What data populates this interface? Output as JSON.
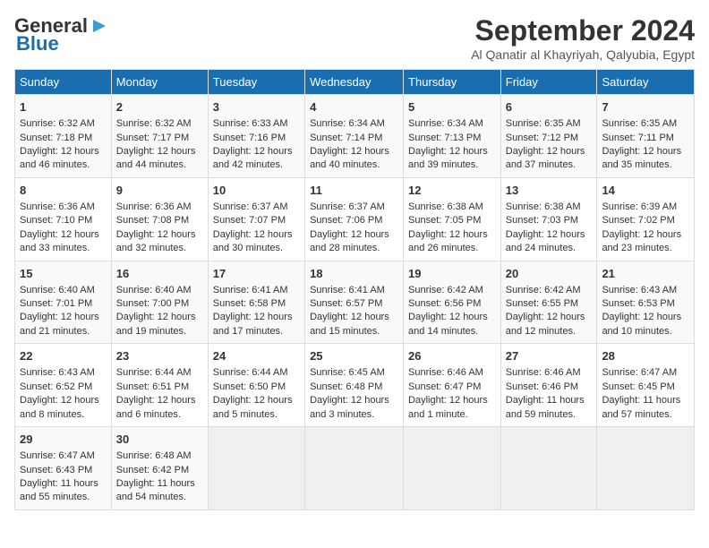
{
  "logo": {
    "line1": "General",
    "line2": "Blue"
  },
  "title": "September 2024",
  "subtitle": "Al Qanatir al Khayriyah, Qalyubia, Egypt",
  "days_of_week": [
    "Sunday",
    "Monday",
    "Tuesday",
    "Wednesday",
    "Thursday",
    "Friday",
    "Saturday"
  ],
  "weeks": [
    [
      {
        "day": 1,
        "sunrise": "6:32 AM",
        "sunset": "7:18 PM",
        "daylight": "12 hours and 46 minutes."
      },
      {
        "day": 2,
        "sunrise": "6:32 AM",
        "sunset": "7:17 PM",
        "daylight": "12 hours and 44 minutes."
      },
      {
        "day": 3,
        "sunrise": "6:33 AM",
        "sunset": "7:16 PM",
        "daylight": "12 hours and 42 minutes."
      },
      {
        "day": 4,
        "sunrise": "6:34 AM",
        "sunset": "7:14 PM",
        "daylight": "12 hours and 40 minutes."
      },
      {
        "day": 5,
        "sunrise": "6:34 AM",
        "sunset": "7:13 PM",
        "daylight": "12 hours and 39 minutes."
      },
      {
        "day": 6,
        "sunrise": "6:35 AM",
        "sunset": "7:12 PM",
        "daylight": "12 hours and 37 minutes."
      },
      {
        "day": 7,
        "sunrise": "6:35 AM",
        "sunset": "7:11 PM",
        "daylight": "12 hours and 35 minutes."
      }
    ],
    [
      {
        "day": 8,
        "sunrise": "6:36 AM",
        "sunset": "7:10 PM",
        "daylight": "12 hours and 33 minutes."
      },
      {
        "day": 9,
        "sunrise": "6:36 AM",
        "sunset": "7:08 PM",
        "daylight": "12 hours and 32 minutes."
      },
      {
        "day": 10,
        "sunrise": "6:37 AM",
        "sunset": "7:07 PM",
        "daylight": "12 hours and 30 minutes."
      },
      {
        "day": 11,
        "sunrise": "6:37 AM",
        "sunset": "7:06 PM",
        "daylight": "12 hours and 28 minutes."
      },
      {
        "day": 12,
        "sunrise": "6:38 AM",
        "sunset": "7:05 PM",
        "daylight": "12 hours and 26 minutes."
      },
      {
        "day": 13,
        "sunrise": "6:38 AM",
        "sunset": "7:03 PM",
        "daylight": "12 hours and 24 minutes."
      },
      {
        "day": 14,
        "sunrise": "6:39 AM",
        "sunset": "7:02 PM",
        "daylight": "12 hours and 23 minutes."
      }
    ],
    [
      {
        "day": 15,
        "sunrise": "6:40 AM",
        "sunset": "7:01 PM",
        "daylight": "12 hours and 21 minutes."
      },
      {
        "day": 16,
        "sunrise": "6:40 AM",
        "sunset": "7:00 PM",
        "daylight": "12 hours and 19 minutes."
      },
      {
        "day": 17,
        "sunrise": "6:41 AM",
        "sunset": "6:58 PM",
        "daylight": "12 hours and 17 minutes."
      },
      {
        "day": 18,
        "sunrise": "6:41 AM",
        "sunset": "6:57 PM",
        "daylight": "12 hours and 15 minutes."
      },
      {
        "day": 19,
        "sunrise": "6:42 AM",
        "sunset": "6:56 PM",
        "daylight": "12 hours and 14 minutes."
      },
      {
        "day": 20,
        "sunrise": "6:42 AM",
        "sunset": "6:55 PM",
        "daylight": "12 hours and 12 minutes."
      },
      {
        "day": 21,
        "sunrise": "6:43 AM",
        "sunset": "6:53 PM",
        "daylight": "12 hours and 10 minutes."
      }
    ],
    [
      {
        "day": 22,
        "sunrise": "6:43 AM",
        "sunset": "6:52 PM",
        "daylight": "12 hours and 8 minutes."
      },
      {
        "day": 23,
        "sunrise": "6:44 AM",
        "sunset": "6:51 PM",
        "daylight": "12 hours and 6 minutes."
      },
      {
        "day": 24,
        "sunrise": "6:44 AM",
        "sunset": "6:50 PM",
        "daylight": "12 hours and 5 minutes."
      },
      {
        "day": 25,
        "sunrise": "6:45 AM",
        "sunset": "6:48 PM",
        "daylight": "12 hours and 3 minutes."
      },
      {
        "day": 26,
        "sunrise": "6:46 AM",
        "sunset": "6:47 PM",
        "daylight": "12 hours and 1 minute."
      },
      {
        "day": 27,
        "sunrise": "6:46 AM",
        "sunset": "6:46 PM",
        "daylight": "11 hours and 59 minutes."
      },
      {
        "day": 28,
        "sunrise": "6:47 AM",
        "sunset": "6:45 PM",
        "daylight": "11 hours and 57 minutes."
      }
    ],
    [
      {
        "day": 29,
        "sunrise": "6:47 AM",
        "sunset": "6:43 PM",
        "daylight": "11 hours and 55 minutes."
      },
      {
        "day": 30,
        "sunrise": "6:48 AM",
        "sunset": "6:42 PM",
        "daylight": "11 hours and 54 minutes."
      },
      null,
      null,
      null,
      null,
      null
    ]
  ],
  "labels": {
    "sunrise": "Sunrise:",
    "sunset": "Sunset:",
    "daylight": "Daylight hours"
  }
}
